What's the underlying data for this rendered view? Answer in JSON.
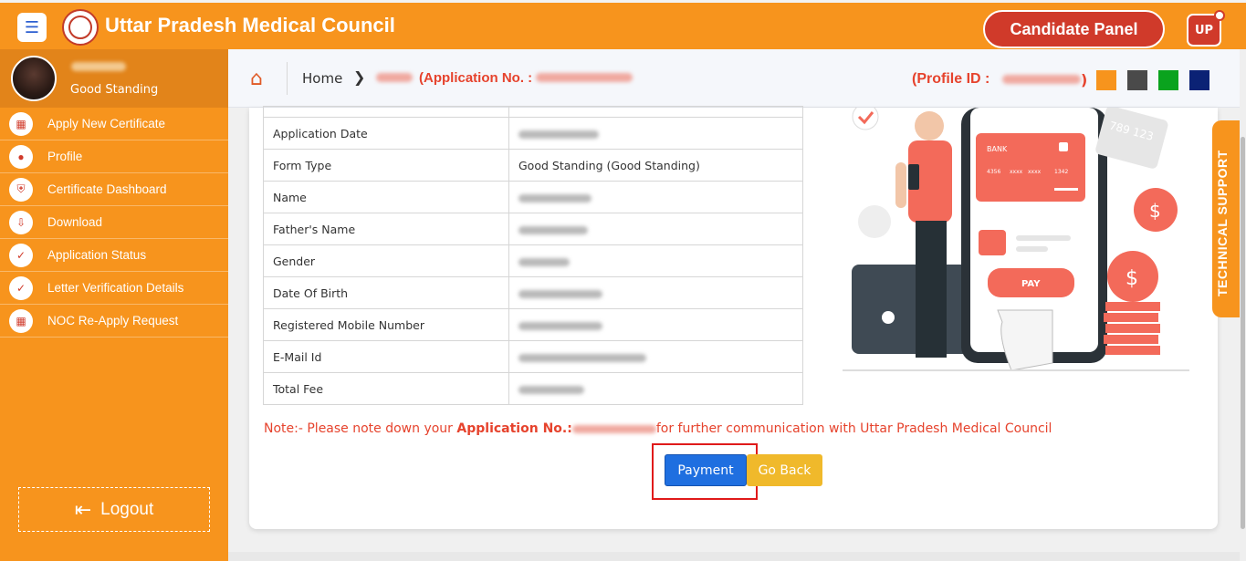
{
  "header": {
    "menu_icon": "hamburger-icon",
    "logo": "council-seal-logo",
    "title": "Uttar Pradesh Medical Council",
    "candidate_panel": "Candidate Panel",
    "user_badge": "UP"
  },
  "sidebar": {
    "profile_status": "Good Standing",
    "items": [
      {
        "label": "Apply New Certificate",
        "icon": "grid-icon"
      },
      {
        "label": "Profile",
        "icon": "user-icon"
      },
      {
        "label": "Certificate Dashboard",
        "icon": "shield-icon"
      },
      {
        "label": "Download",
        "icon": "download-icon"
      },
      {
        "label": "Application Status",
        "icon": "check-circle-icon"
      },
      {
        "label": "Letter Verification Details",
        "icon": "check-circle-icon"
      },
      {
        "label": "NOC Re-Apply Request",
        "icon": "grid-icon"
      }
    ],
    "logout": "Logout"
  },
  "breadcrumb": {
    "home": "Home",
    "application_label": "(Application No. :",
    "application_close": ")",
    "profile_id_label": "(Profile ID :",
    "profile_id_close": ")"
  },
  "theme_colors": [
    "#f7941d",
    "#4a4a4a",
    "#0aa31e",
    "#0b2275"
  ],
  "details": {
    "rows": [
      {
        "label": "Application Date",
        "value": ""
      },
      {
        "label": "Form Type",
        "value": "Good Standing (Good Standing)"
      },
      {
        "label": "Name",
        "value": ""
      },
      {
        "label": "Father's Name",
        "value": ""
      },
      {
        "label": "Gender",
        "value": ""
      },
      {
        "label": "Date Of Birth",
        "value": ""
      },
      {
        "label": "Registered Mobile Number",
        "value": ""
      },
      {
        "label": "E-Mail Id",
        "value": ""
      },
      {
        "label": "Total Fee",
        "value": ""
      }
    ]
  },
  "note": {
    "prefix": "Note:- Please note down your ",
    "bold": "Application No.:",
    "suffix": "for further communication with Uttar Pradesh Medical Council"
  },
  "buttons": {
    "payment": "Payment",
    "go_back": "Go Back"
  },
  "illustration": {
    "card_label": "BANK",
    "card_digits": [
      "4356",
      "xxxx",
      "xxxx",
      "1342"
    ],
    "pay_label": "PAY",
    "back_card_digits": "789 123"
  },
  "tech_support": "TECHNICAL SUPPORT"
}
